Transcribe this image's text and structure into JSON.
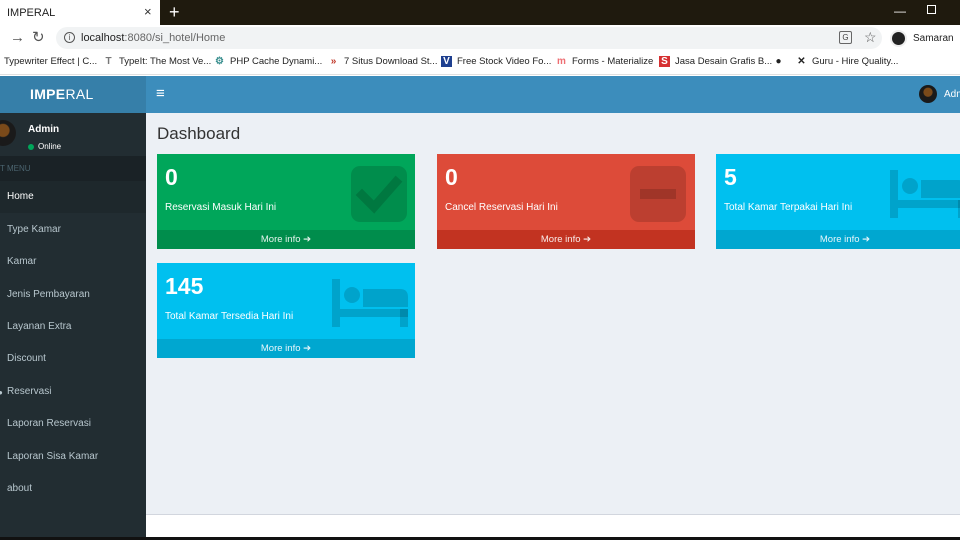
{
  "browser": {
    "tab_title": "IMPERAL",
    "tab_close": "×",
    "new_tab": "+",
    "url_host": "localhost",
    "url_rest": ":8080/si_hotel/Home",
    "profile_name": "Samaran"
  },
  "bookmarks": [
    {
      "label": "Typewriter Effect | C...",
      "icon": "none"
    },
    {
      "label": "TypeIt: The Most Ve...",
      "icon": "T"
    },
    {
      "label": "PHP Cache Dynami...",
      "icon": "gear"
    },
    {
      "label": "7 Situs Download St...",
      "icon": "chevrons"
    },
    {
      "label": "Free Stock Video Fo...",
      "icon": "V"
    },
    {
      "label": "Forms - Materialize",
      "icon": "m"
    },
    {
      "label": "Jasa Desain Grafis B...",
      "icon": "S"
    },
    {
      "label": "",
      "icon": "globe"
    },
    {
      "label": "Guru - Hire Quality...",
      "icon": "guru"
    }
  ],
  "header": {
    "brand_bold": "IMPE",
    "brand_rest": "RAL",
    "hamburger": "≡",
    "user_name": "Adm"
  },
  "sidebar": {
    "user_name": "Admin",
    "status": "Online",
    "menu_header": "T MENU",
    "items": [
      {
        "label": "Home",
        "active": true
      },
      {
        "label": "Type Kamar",
        "active": false
      },
      {
        "label": "Kamar",
        "active": false
      },
      {
        "label": "Jenis Pembayaran",
        "active": false
      },
      {
        "label": "Layanan Extra",
        "active": false
      },
      {
        "label": "Discount",
        "active": false
      },
      {
        "label": "Reservasi",
        "active": false
      },
      {
        "label": "Laporan Reservasi",
        "active": false
      },
      {
        "label": "Laporan Sisa Kamar",
        "active": false
      },
      {
        "label": "about",
        "active": false
      }
    ]
  },
  "main": {
    "title": "Dashboard",
    "boxes": [
      {
        "number": "0",
        "label": "Reservasi Masuk Hari Ini",
        "footer": "More info",
        "color": "#00a65a",
        "icon": "check-square-icon"
      },
      {
        "number": "0",
        "label": "Cancel Reservasi Hari Ini",
        "footer": "More info",
        "color": "#dd4b39",
        "icon": "minus-square-icon"
      },
      {
        "number": "5",
        "label": "Total Kamar Terpakai Hari Ini",
        "footer": "More info",
        "color": "#00c0ef",
        "icon": "bed-icon"
      },
      {
        "number": "145",
        "label": "Total Kamar Tersedia Hari Ini",
        "footer": "More info",
        "color": "#00c0ef",
        "icon": "bed-icon"
      }
    ]
  }
}
